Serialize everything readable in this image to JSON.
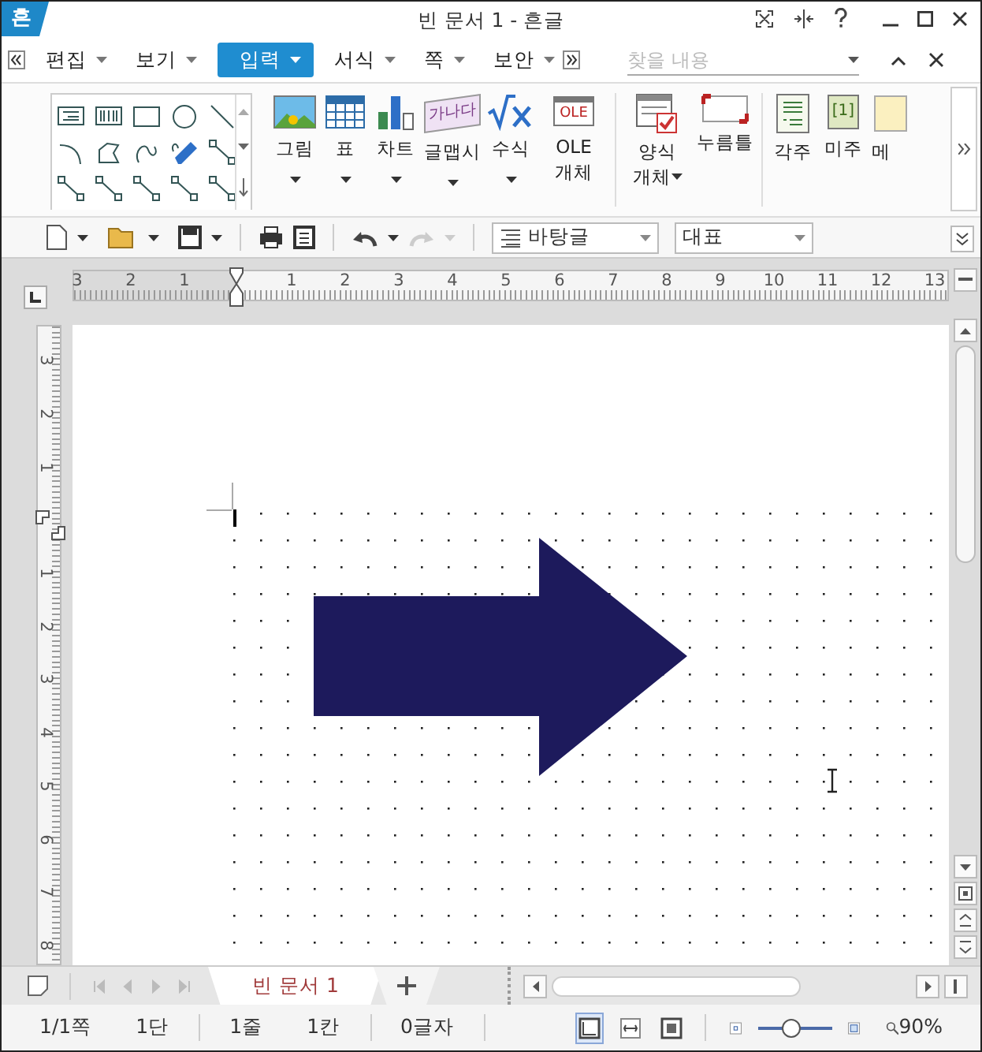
{
  "app": {
    "logo": "흔",
    "title": "빈 문서 1 - 흔글"
  },
  "menu": {
    "items": [
      {
        "label": "편집",
        "selected": false
      },
      {
        "label": "보기",
        "selected": false
      },
      {
        "label": "입력",
        "selected": true
      },
      {
        "label": "서식",
        "selected": false
      },
      {
        "label": "쪽",
        "selected": false
      },
      {
        "label": "보안",
        "selected": false
      }
    ],
    "search": {
      "placeholder": "찾을 내용"
    }
  },
  "ribbon": {
    "groups": [
      {
        "buttons": [
          {
            "label": "그림",
            "kind": "picture",
            "dropdown": true
          },
          {
            "label": "표",
            "kind": "table",
            "dropdown": true
          },
          {
            "label": "차트",
            "kind": "chart",
            "dropdown": true
          },
          {
            "label": "글맵시",
            "kind": "wordart",
            "icon_text": "가나다",
            "dropdown": true
          },
          {
            "label": "수식",
            "kind": "formula",
            "dropdown": true
          },
          {
            "label": "OLE 개체",
            "kind": "ole",
            "icon_text": "OLE"
          }
        ]
      },
      {
        "buttons": [
          {
            "label": "양식 개체",
            "kind": "form",
            "dropdown": true
          },
          {
            "label": "누름틀",
            "kind": "field"
          }
        ]
      },
      {
        "buttons": [
          {
            "label": "각주",
            "kind": "footnote"
          },
          {
            "label": "미주",
            "kind": "endnote",
            "icon_text": "[1]"
          },
          {
            "label": "메",
            "kind": "memo"
          }
        ]
      }
    ]
  },
  "toolbar": {
    "style": "바탕글",
    "font": "대표"
  },
  "ruler": {
    "labels": [
      "3",
      "2",
      "1",
      "1",
      "2",
      "3",
      "4",
      "5",
      "6",
      "7",
      "8",
      "9",
      "10",
      "11",
      "12",
      "13"
    ]
  },
  "vertical_ruler": {
    "labels": [
      "3",
      "2",
      "1",
      "1",
      "2",
      "3",
      "4",
      "5",
      "6",
      "7",
      "8"
    ]
  },
  "tabs": [
    {
      "label": "빈 문서 1",
      "selected": true
    }
  ],
  "status_bar": {
    "items": [
      "1/1쪽",
      "1단",
      "1줄",
      "1칸",
      "0글자"
    ],
    "views": [
      {
        "kind": "page",
        "selected": true
      },
      {
        "kind": "width",
        "selected": false
      },
      {
        "kind": "full",
        "selected": false
      }
    ],
    "zoom": {
      "level": 0.44,
      "reading": "90%"
    }
  }
}
